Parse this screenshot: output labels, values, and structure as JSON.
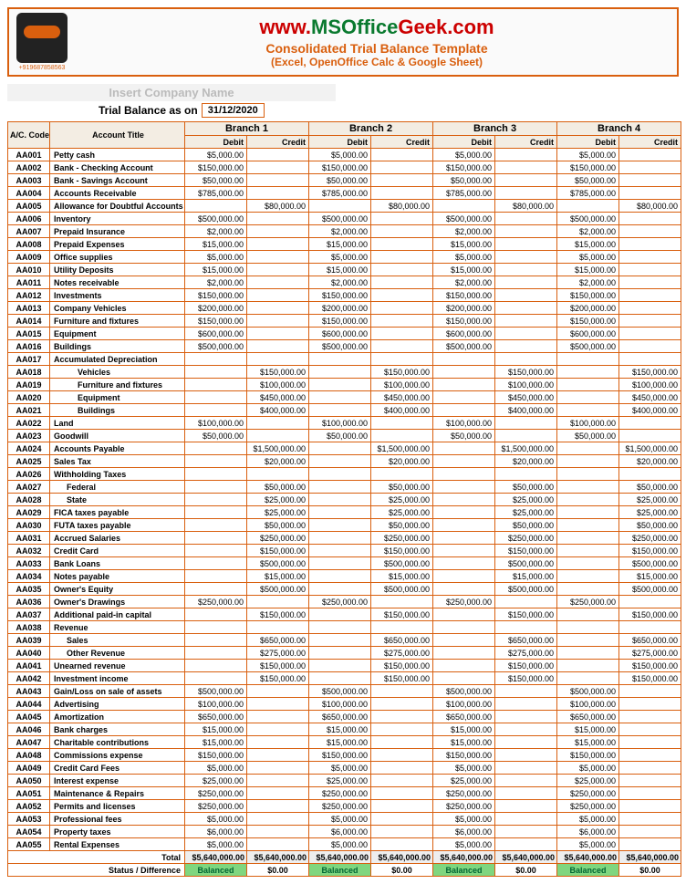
{
  "header": {
    "phone": "+919687858563",
    "url_pre": "www.",
    "url_ms": "MSOffice",
    "url_geek": "Geek",
    "url_com": ".com",
    "subtitle": "Consolidated Trial Balance Template",
    "subtitle2": "(Excel, OpenOffice Calc & Google Sheet)"
  },
  "company_placeholder": "Insert Company Name",
  "date_label": "Trial Balance as on",
  "date_value": "31/12/2020",
  "branches": [
    "Branch 1",
    "Branch 2",
    "Branch 3",
    "Branch 4"
  ],
  "col_code": "A/C. Code",
  "col_title": "Account Title",
  "col_debit": "Debit",
  "col_credit": "Credit",
  "rows": [
    {
      "code": "AA001",
      "title": "Petty cash",
      "indent": 0,
      "d": "$5,000.00",
      "c": ""
    },
    {
      "code": "AA002",
      "title": "Bank - Checking Account",
      "indent": 0,
      "d": "$150,000.00",
      "c": ""
    },
    {
      "code": "AA003",
      "title": "Bank - Savings Account",
      "indent": 0,
      "d": "$50,000.00",
      "c": ""
    },
    {
      "code": "AA004",
      "title": "Accounts Receivable",
      "indent": 0,
      "d": "$785,000.00",
      "c": ""
    },
    {
      "code": "AA005",
      "title": "Allowance for Doubtful Accounts",
      "indent": 0,
      "d": "",
      "c": "$80,000.00"
    },
    {
      "code": "AA006",
      "title": "Inventory",
      "indent": 0,
      "d": "$500,000.00",
      "c": ""
    },
    {
      "code": "AA007",
      "title": "Prepaid Insurance",
      "indent": 0,
      "d": "$2,000.00",
      "c": ""
    },
    {
      "code": "AA008",
      "title": "Prepaid Expenses",
      "indent": 0,
      "d": "$15,000.00",
      "c": ""
    },
    {
      "code": "AA009",
      "title": "Office supplies",
      "indent": 0,
      "d": "$5,000.00",
      "c": ""
    },
    {
      "code": "AA010",
      "title": "Utility Deposits",
      "indent": 0,
      "d": "$15,000.00",
      "c": ""
    },
    {
      "code": "AA011",
      "title": "Notes receivable",
      "indent": 0,
      "d": "$2,000.00",
      "c": ""
    },
    {
      "code": "AA012",
      "title": "Investments",
      "indent": 0,
      "d": "$150,000.00",
      "c": ""
    },
    {
      "code": "AA013",
      "title": "Company Vehicles",
      "indent": 0,
      "d": "$200,000.00",
      "c": ""
    },
    {
      "code": "AA014",
      "title": "Furniture and fixtures",
      "indent": 0,
      "d": "$150,000.00",
      "c": ""
    },
    {
      "code": "AA015",
      "title": "Equipment",
      "indent": 0,
      "d": "$600,000.00",
      "c": ""
    },
    {
      "code": "AA016",
      "title": "Buildings",
      "indent": 0,
      "d": "$500,000.00",
      "c": ""
    },
    {
      "code": "AA017",
      "title": "Accumulated Depreciation",
      "indent": 0,
      "d": "",
      "c": ""
    },
    {
      "code": "AA018",
      "title": "Vehicles",
      "indent": 2,
      "d": "",
      "c": "$150,000.00"
    },
    {
      "code": "AA019",
      "title": "Furniture and fixtures",
      "indent": 2,
      "d": "",
      "c": "$100,000.00"
    },
    {
      "code": "AA020",
      "title": "Equipment",
      "indent": 2,
      "d": "",
      "c": "$450,000.00"
    },
    {
      "code": "AA021",
      "title": "Buildings",
      "indent": 2,
      "d": "",
      "c": "$400,000.00"
    },
    {
      "code": "AA022",
      "title": "Land",
      "indent": 0,
      "d": "$100,000.00",
      "c": ""
    },
    {
      "code": "AA023",
      "title": "Goodwill",
      "indent": 0,
      "d": "$50,000.00",
      "c": ""
    },
    {
      "code": "AA024",
      "title": "Accounts Payable",
      "indent": 0,
      "d": "",
      "c": "$1,500,000.00"
    },
    {
      "code": "AA025",
      "title": "Sales Tax",
      "indent": 0,
      "d": "",
      "c": "$20,000.00"
    },
    {
      "code": "AA026",
      "title": "Withholding Taxes",
      "indent": 0,
      "d": "",
      "c": ""
    },
    {
      "code": "AA027",
      "title": "Federal",
      "indent": 1,
      "d": "",
      "c": "$50,000.00"
    },
    {
      "code": "AA028",
      "title": "State",
      "indent": 1,
      "d": "",
      "c": "$25,000.00"
    },
    {
      "code": "AA029",
      "title": "FICA taxes payable",
      "indent": 0,
      "d": "",
      "c": "$25,000.00"
    },
    {
      "code": "AA030",
      "title": "FUTA taxes payable",
      "indent": 0,
      "d": "",
      "c": "$50,000.00"
    },
    {
      "code": "AA031",
      "title": "Accrued Salaries",
      "indent": 0,
      "d": "",
      "c": "$250,000.00"
    },
    {
      "code": "AA032",
      "title": "Credit Card",
      "indent": 0,
      "d": "",
      "c": "$150,000.00"
    },
    {
      "code": "AA033",
      "title": "Bank Loans",
      "indent": 0,
      "d": "",
      "c": "$500,000.00"
    },
    {
      "code": "AA034",
      "title": "Notes payable",
      "indent": 0,
      "d": "",
      "c": "$15,000.00"
    },
    {
      "code": "AA035",
      "title": "Owner's Equity",
      "indent": 0,
      "d": "",
      "c": "$500,000.00"
    },
    {
      "code": "AA036",
      "title": "Owner's Drawings",
      "indent": 0,
      "d": "$250,000.00",
      "c": ""
    },
    {
      "code": "AA037",
      "title": "Additional paid-in capital",
      "indent": 0,
      "d": "",
      "c": "$150,000.00"
    },
    {
      "code": "AA038",
      "title": "Revenue",
      "indent": 0,
      "d": "",
      "c": ""
    },
    {
      "code": "AA039",
      "title": "Sales",
      "indent": 1,
      "d": "",
      "c": "$650,000.00"
    },
    {
      "code": "AA040",
      "title": "Other Revenue",
      "indent": 1,
      "d": "",
      "c": "$275,000.00"
    },
    {
      "code": "AA041",
      "title": "Unearned revenue",
      "indent": 0,
      "d": "",
      "c": "$150,000.00"
    },
    {
      "code": "AA042",
      "title": "Investment income",
      "indent": 0,
      "d": "",
      "c": "$150,000.00"
    },
    {
      "code": "AA043",
      "title": "Gain/Loss on sale of assets",
      "indent": 0,
      "d": "$500,000.00",
      "c": ""
    },
    {
      "code": "AA044",
      "title": "Advertising",
      "indent": 0,
      "d": "$100,000.00",
      "c": ""
    },
    {
      "code": "AA045",
      "title": "Amortization",
      "indent": 0,
      "d": "$650,000.00",
      "c": ""
    },
    {
      "code": "AA046",
      "title": "Bank charges",
      "indent": 0,
      "d": "$15,000.00",
      "c": ""
    },
    {
      "code": "AA047",
      "title": "Charitable contributions",
      "indent": 0,
      "d": "$15,000.00",
      "c": ""
    },
    {
      "code": "AA048",
      "title": "Commissions expense",
      "indent": 0,
      "d": "$150,000.00",
      "c": ""
    },
    {
      "code": "AA049",
      "title": "Credit Card Fees",
      "indent": 0,
      "d": "$5,000.00",
      "c": ""
    },
    {
      "code": "AA050",
      "title": "Interest expense",
      "indent": 0,
      "d": "$25,000.00",
      "c": ""
    },
    {
      "code": "AA051",
      "title": "Maintenance & Repairs",
      "indent": 0,
      "d": "$250,000.00",
      "c": ""
    },
    {
      "code": "AA052",
      "title": "Permits and licenses",
      "indent": 0,
      "d": "$250,000.00",
      "c": ""
    },
    {
      "code": "AA053",
      "title": "Professional fees",
      "indent": 0,
      "d": "$5,000.00",
      "c": ""
    },
    {
      "code": "AA054",
      "title": "Property taxes",
      "indent": 0,
      "d": "$6,000.00",
      "c": ""
    },
    {
      "code": "AA055",
      "title": "Rental Expenses",
      "indent": 0,
      "d": "$5,000.00",
      "c": ""
    }
  ],
  "total_label": "Total",
  "total_d": "$5,640,000.00",
  "total_c": "$5,640,000.00",
  "status_label": "Status / Difference",
  "status_bal": "Balanced",
  "status_diff": "$0.00"
}
